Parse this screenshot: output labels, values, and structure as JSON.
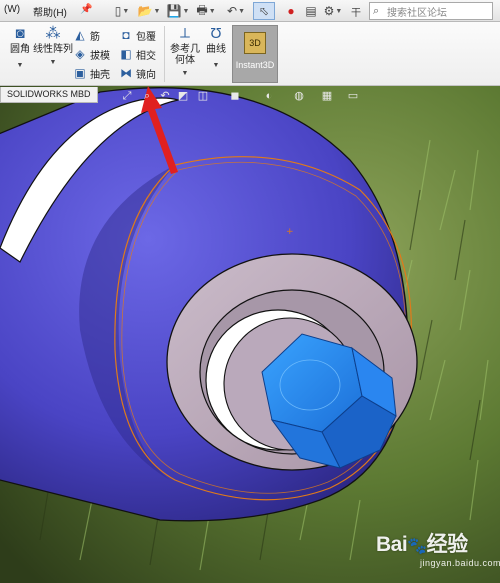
{
  "menu": {
    "item_w": "(W)",
    "help": "帮助(H)",
    "pin": "📌"
  },
  "quick_access": {
    "new": "▯",
    "open": "📂",
    "save": "💾",
    "print": "🖶",
    "undo": "↶",
    "select": "⬁",
    "rebuild": "●",
    "file_props": "▤",
    "options": "⚙",
    "more": "干"
  },
  "search": {
    "placeholder": "搜索社区论坛"
  },
  "commands": {
    "fillet": "圆角",
    "linear_pattern": "线性阵列",
    "rib": "筋",
    "draft": "拔模",
    "shell": "抽壳",
    "wrap": "包覆",
    "intersect": "相交",
    "mirror": "镜向",
    "reference_geometry": "参考几何体",
    "curves": "曲线",
    "instant3d": "Instant3D"
  },
  "tabs": {
    "active": "SOLIDWORKS MBD"
  },
  "watermark": {
    "brand": "Bai",
    "brand2": "经验",
    "sub": "jingyan.baidu.com"
  },
  "colors": {
    "part_body": "#4a45c8",
    "face_face": "#b7a6b8",
    "hex_bolt": "#2f8fff",
    "annotation_arrow": "#e02020",
    "selection_edge": "#e07a1a"
  }
}
